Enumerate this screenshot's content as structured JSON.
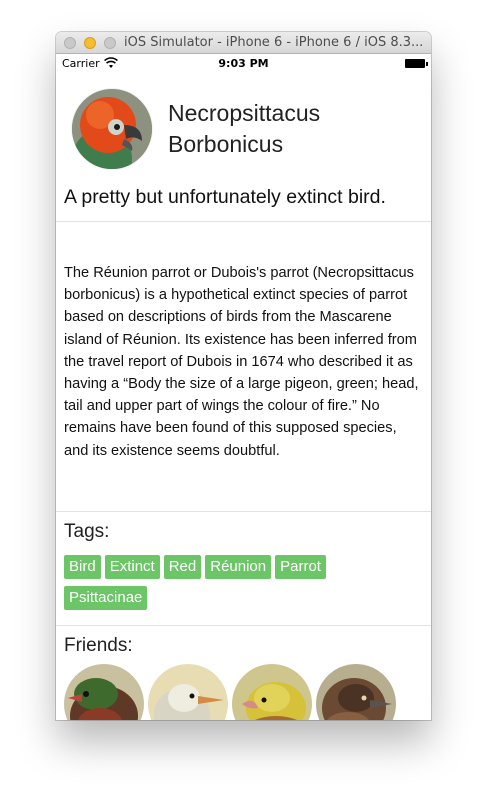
{
  "window": {
    "title": "iOS Simulator - iPhone 6 - iPhone 6 / iOS 8.3..."
  },
  "status_bar": {
    "carrier": "Carrier",
    "time": "9:03 PM"
  },
  "profile": {
    "name_line1": "Necropsittacus",
    "name_line2": "Borbonicus",
    "tagline": "A pretty but unfortunately extinct bird.",
    "description": "The Réunion parrot or Dubois's parrot (Necropsittacus  borbonicus) is a hypothetical extinct species of parrot based on descriptions of birds from the Mascarene island of Réunion. Its existence has been inferred from the travel report of Dubois in 1674 who described it as having a “Body the size of a large pigeon, green; head, tail and upper part of wings the colour of fire.” No remains have been found of this supposed species, and its existence seems doubtful."
  },
  "tags_section": {
    "label": "Tags:",
    "items": [
      "Bird",
      "Extinct",
      "Red",
      "Réunion",
      "Parrot",
      "Psittacinae"
    ],
    "tag_color": "#6cc567"
  },
  "friends_section": {
    "label": "Friends:",
    "items": [
      {
        "icon": "bird-avatar-red-throat"
      },
      {
        "icon": "bird-avatar-white"
      },
      {
        "icon": "bird-avatar-yellow"
      },
      {
        "icon": "bird-avatar-brown"
      }
    ]
  },
  "colors": {
    "traffic_minimize": "#f5be2e",
    "divider": "#e3e3e3"
  }
}
